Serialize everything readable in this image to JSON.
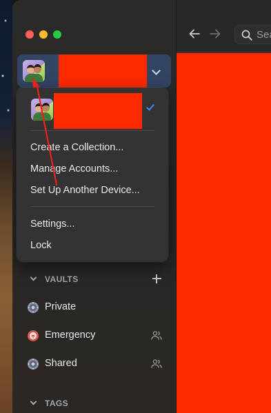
{
  "window": {
    "traffic_lights": [
      "close",
      "minimize",
      "maximize"
    ]
  },
  "account_switcher": {
    "avatar_icon": "avatar-icon",
    "chevron_icon": "chevron-down-icon"
  },
  "account_menu": {
    "checkmark_icon": "checkmark-icon",
    "items_group1": [
      "Create a Collection...",
      "Manage Accounts...",
      "Set Up Another Device..."
    ],
    "items_group2": [
      "Settings...",
      "Lock"
    ]
  },
  "sidebar": {
    "vaults_header": "VAULTS",
    "vaults": [
      {
        "label": "Private",
        "icon": "vault-icon",
        "shared": false
      },
      {
        "label": "Emergency",
        "icon": "emergency-vault-icon",
        "shared": true
      },
      {
        "label": "Shared",
        "icon": "vault-icon",
        "shared": true
      }
    ],
    "tags_header": "TAGS"
  },
  "toolbar": {
    "search_placeholder": "Search"
  },
  "colors": {
    "accent": "#3c8cf5",
    "account_bar": "#324563",
    "redaction": "#ff2a00",
    "annotation_arrow": "#e8231b"
  }
}
